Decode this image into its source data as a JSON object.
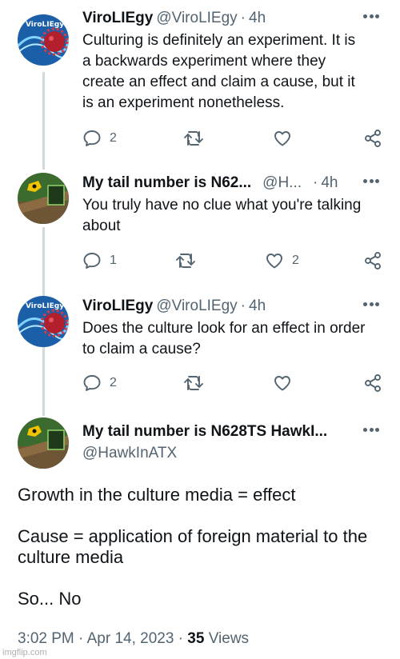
{
  "tweets": [
    {
      "name": "ViroLIEgy",
      "handle": "@ViroLIEgy",
      "sep": "·",
      "time": "4h",
      "text_lines": [
        "Culturing is definitely an experiment. It is",
        "a backwards experiment where they",
        "create an effect and claim a cause, but it",
        "is an experiment nonetheless."
      ],
      "replies": "2",
      "retweets": "",
      "likes": ""
    },
    {
      "name": "My tail number is N62...",
      "handle": "@H...",
      "sep": "·",
      "time": "4h",
      "text_lines": [
        "You truly have no clue what you're talking",
        "about"
      ],
      "replies": "1",
      "retweets": "",
      "likes": "2"
    },
    {
      "name": "ViroLIEgy",
      "handle": "@ViroLIEgy",
      "sep": "·",
      "time": "4h",
      "text_lines": [
        "Does the culture look for an effect in order",
        "to claim a cause?"
      ],
      "replies": "2",
      "retweets": "",
      "likes": ""
    }
  ],
  "main_tweet": {
    "name": "My tail number is N628TS HawkI...",
    "handle": "@HawkInATX",
    "paragraphs": [
      "Growth in the culture media = effect",
      "Cause = application of foreign material to the culture media",
      "So... No"
    ],
    "timestamp": "3:02 PM · Apr 14, 2023 · ",
    "views_count": "35",
    "views_label": " Views"
  },
  "avatar_text": "ViroLIEgy",
  "watermark": "imgflip.com",
  "colors": {
    "text": "#0f1419",
    "muted": "#536471",
    "thread_line": "#cfd9de"
  }
}
